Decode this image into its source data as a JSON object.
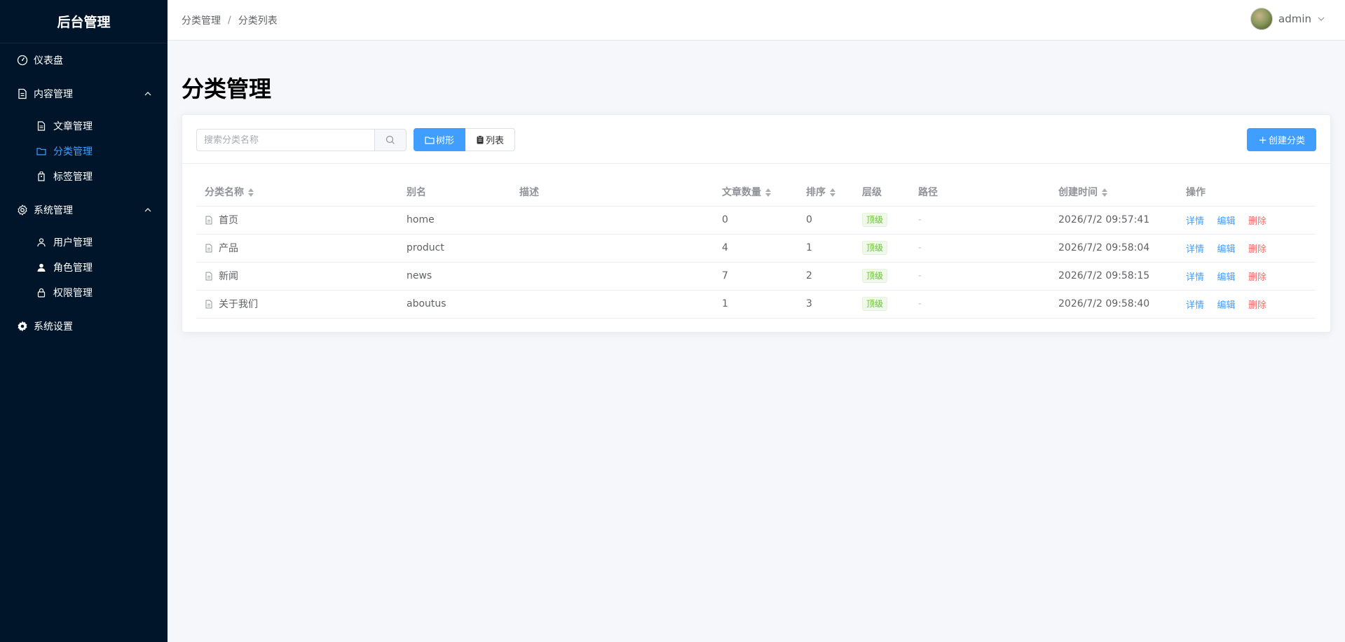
{
  "sidebar": {
    "brand": "后台管理",
    "dashboard": "仪表盘",
    "content_group": "内容管理",
    "content_items": [
      {
        "label": "文章管理",
        "icon": "document-icon"
      },
      {
        "label": "分类管理",
        "icon": "folder-icon"
      },
      {
        "label": "标签管理",
        "icon": "tag-icon"
      }
    ],
    "system_group": "系统管理",
    "system_items": [
      {
        "label": "用户管理",
        "icon": "user-icon"
      },
      {
        "label": "角色管理",
        "icon": "role-icon"
      },
      {
        "label": "权限管理",
        "icon": "lock-icon"
      }
    ],
    "settings": "系统设置",
    "active_color": "#409eff",
    "bg_color": "#001529"
  },
  "header": {
    "breadcrumb": [
      "分类管理",
      "分类列表"
    ],
    "separator": "/",
    "username": "admin"
  },
  "main": {
    "title": "分类管理",
    "search_placeholder": "搜索分类名称",
    "view_tree": "树形",
    "view_list": "列表",
    "create_label": "创建分类",
    "columns": [
      "分类名称",
      "别名",
      "描述",
      "文章数量",
      "排序",
      "层级",
      "路径",
      "创建时间",
      "操作"
    ],
    "rows": [
      {
        "name": "首页",
        "alias": "home",
        "desc": "",
        "count": "0",
        "sort": "0",
        "level": "顶级",
        "path": "-",
        "created": "2026/7/2 09:57:41"
      },
      {
        "name": "产品",
        "alias": "product",
        "desc": "",
        "count": "4",
        "sort": "1",
        "level": "顶级",
        "path": "-",
        "created": "2026/7/2 09:58:04"
      },
      {
        "name": "新闻",
        "alias": "news",
        "desc": "",
        "count": "7",
        "sort": "2",
        "level": "顶级",
        "path": "-",
        "created": "2026/7/2 09:58:15"
      },
      {
        "name": "关于我们",
        "alias": "aboutus",
        "desc": "",
        "count": "1",
        "sort": "3",
        "level": "顶级",
        "path": "-",
        "created": "2026/7/2 09:58:40"
      }
    ],
    "actions": {
      "detail": "详情",
      "edit": "编辑",
      "delete": "删除"
    },
    "accent_color": "#409eff",
    "danger_color": "#f56c6c"
  }
}
